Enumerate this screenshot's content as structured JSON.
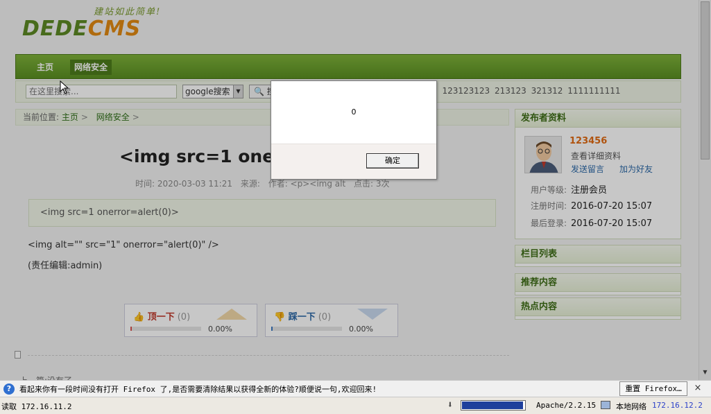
{
  "logo": {
    "slogan": "建站如此简单!",
    "brand_dede": "DEDE",
    "brand_cms": "CMS"
  },
  "nav": {
    "items": [
      {
        "label": "主页"
      },
      {
        "label": "网络安全"
      }
    ]
  },
  "search": {
    "placeholder": "在这里搜索...",
    "engine": "google搜索",
    "button_label": "搜",
    "hot_tags": "1  123123123  213123  321312  1111111111"
  },
  "breadcrumb": {
    "prefix": "当前位置:",
    "items": [
      "主页",
      "网络安全"
    ]
  },
  "article": {
    "title": "<img src=1 oner",
    "meta": {
      "time": "时间: 2020-03-03 11:21",
      "source": "来源:",
      "author": "作者: <p><img alt",
      "clicks": "点击: 3次"
    },
    "summary": "<img src=1 onerror=alert(0)>",
    "body_line1": "<img alt=\"\" src=\"1\" onerror=\"alert(0)\" />",
    "body_line2": "(责任编辑:admin)",
    "prev_next": "上一篇:没有了"
  },
  "votes": {
    "up": {
      "label": "顶一下",
      "count": "(0)",
      "percent": "0.00%",
      "fraction": 0.0
    },
    "down": {
      "label": "踩一下",
      "count": "(0)",
      "percent": "0.00%",
      "fraction": 0.0
    }
  },
  "sidebar": {
    "publisher": {
      "heading": "发布者资料",
      "name": "123456",
      "view_profile": "查看详细资料",
      "send_message": "发送留言",
      "add_friend": "加为好友",
      "rows": [
        {
          "key": "用户等级:",
          "value": "注册会员"
        },
        {
          "key": "注册时间:",
          "value": "2016-07-20 15:07"
        },
        {
          "key": "最后登录:",
          "value": "2016-07-20 15:07"
        }
      ]
    },
    "sections": [
      {
        "heading": "栏目列表"
      },
      {
        "heading": "推荐内容"
      },
      {
        "heading": "热点内容"
      }
    ]
  },
  "dialog": {
    "message": "0",
    "ok_label": "确定"
  },
  "notification": {
    "text": "看起来你有一段时间没有打开 Firefox 了,是否需要清除结果以获得全新的体验?顺便说一句,欢迎回来!",
    "reset_label": "重置 Firefox…",
    "close_label": "×"
  },
  "statusbar": {
    "text": "读取 172.16.11.2",
    "progress_fraction": 0.98,
    "server": "Apache/2.2.15",
    "network_label": "本地网络",
    "network_ip": "172.16.12.2"
  },
  "colors": {
    "nav_green": "#5a8f22",
    "brand_orange": "#e28a12",
    "link_green": "#2f6f18",
    "progress_blue": "#1e3f9c"
  }
}
